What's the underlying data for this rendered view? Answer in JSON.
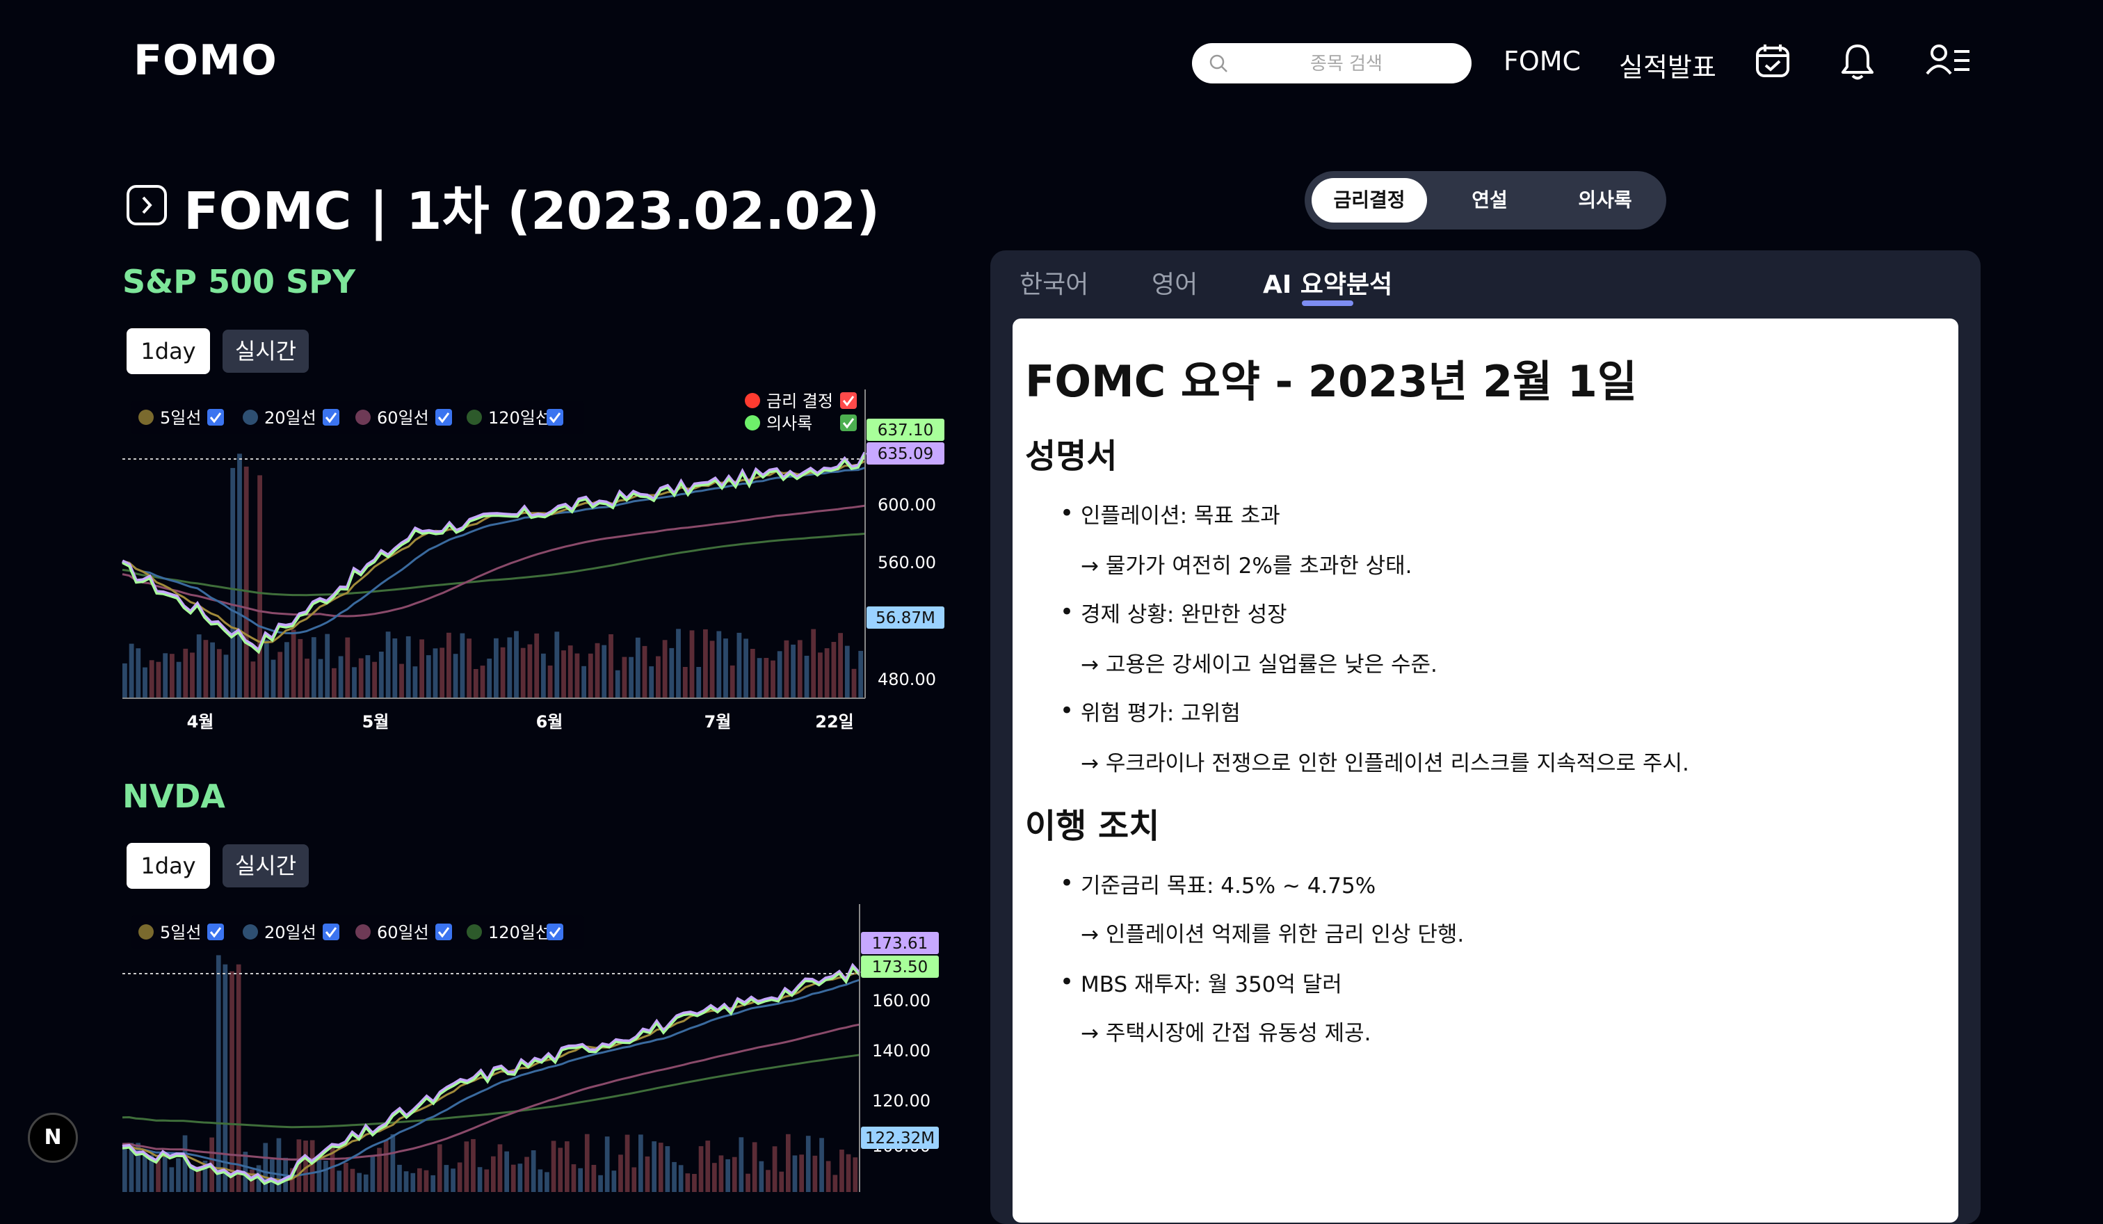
{
  "app": {
    "logo": "FOMO"
  },
  "header": {
    "search_placeholder": "종목 검색",
    "nav": [
      "FOMC",
      "실적발표"
    ]
  },
  "page": {
    "title": "FOMC | 1차 (2023.02.02)"
  },
  "doc_tabs": [
    "금리결정",
    "연설",
    "의사록"
  ],
  "doc_tab_active": 0,
  "charts": [
    {
      "name": "S&P 500 SPY",
      "ranges": [
        "1day",
        "실시간"
      ],
      "active_range": "1day",
      "ma_legend": [
        "5일선",
        "20일선",
        "60일선",
        "120일선"
      ],
      "ma_colors": [
        "#7a6a2e",
        "#2e4f72",
        "#6e3a56",
        "#2d5a2b"
      ],
      "event_legend": [
        {
          "label": "금리 결정",
          "color": "#ff3b30"
        },
        {
          "label": "의사록",
          "color": "#6ef06a"
        }
      ],
      "y_ticks": [
        "600.00",
        "560.00",
        "480.00"
      ],
      "price_tags": [
        "637.10",
        "635.09",
        "56.87M"
      ],
      "x_ticks": [
        "4월",
        "5월",
        "6월",
        "7월",
        "22일"
      ]
    },
    {
      "name": "NVDA",
      "ranges": [
        "1day",
        "실시간"
      ],
      "active_range": "1day",
      "ma_legend": [
        "5일선",
        "20일선",
        "60일선",
        "120일선"
      ],
      "ma_colors": [
        "#7a6a2e",
        "#2e4f72",
        "#6e3a56",
        "#2d5a2b"
      ],
      "y_ticks": [
        "160.00",
        "140.00",
        "120.00",
        "100.00"
      ],
      "price_tags": [
        "173.61",
        "173.50",
        "122.32M"
      ]
    }
  ],
  "lang_tabs": [
    "한국어",
    "영어",
    "AI 요약분석"
  ],
  "lang_tab_active": 2,
  "summary": {
    "title": "FOMC 요약 - 2023년 2월 1일",
    "section1": {
      "heading": "성명서",
      "items": [
        {
          "bullet": "인플레이션: 목표 초과",
          "detail": "→ 물가가 여전히 2%를 초과한 상태."
        },
        {
          "bullet": "경제 상황: 완만한 성장",
          "detail": "→ 고용은 강세이고 실업률은 낮은 수준."
        },
        {
          "bullet": "위험 평가: 고위험",
          "detail": "→ 우크라이나 전쟁으로 인한 인플레이션 리스크를 지속적으로 주시."
        }
      ]
    },
    "section2": {
      "heading": "이행 조치",
      "items": [
        {
          "bullet": "기준금리 목표: 4.5% ~ 4.75%",
          "detail": "→ 인플레이션 억제를 위한 금리 인상 단행."
        },
        {
          "bullet": "MBS 재투자: 월 350억 달러",
          "detail": "→ 주택시장에 간접 유동성 제공."
        }
      ]
    }
  },
  "badge": "N"
}
